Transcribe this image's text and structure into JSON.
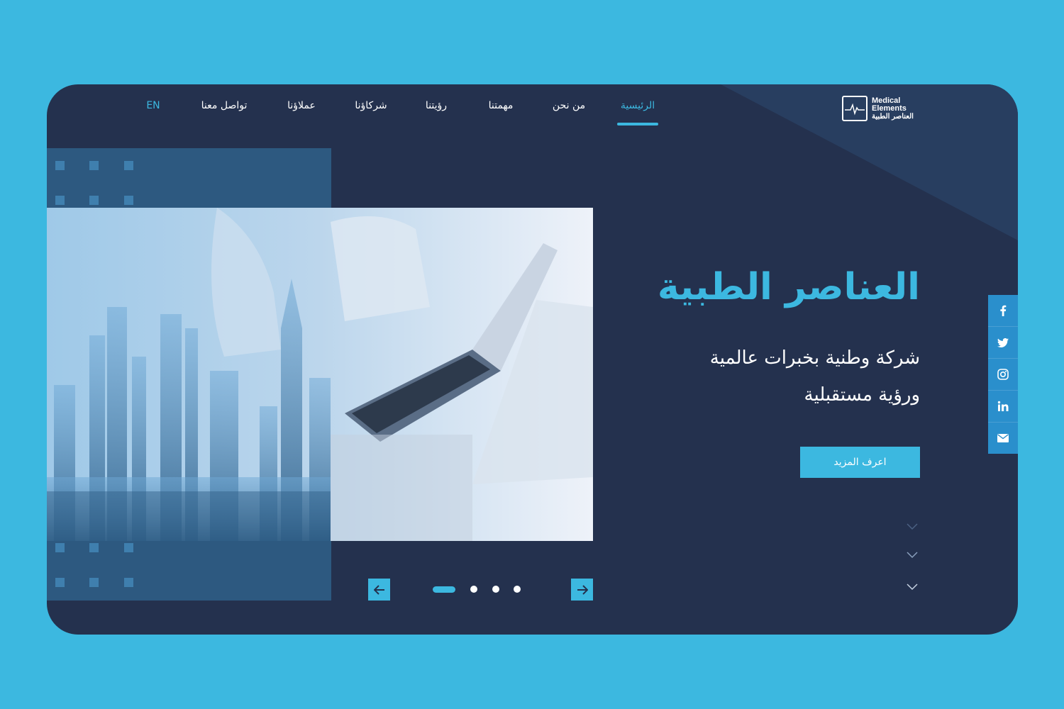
{
  "brand": {
    "name_en_line1": "Medical",
    "name_en_line2": "Elements",
    "name_ar": "العناصر الطبية"
  },
  "nav": {
    "items": [
      {
        "label": "الرئيسية",
        "active": true
      },
      {
        "label": "من نحن",
        "active": false
      },
      {
        "label": "مهمتنا",
        "active": false
      },
      {
        "label": "رؤيتنا",
        "active": false
      },
      {
        "label": "شركاؤنا",
        "active": false
      },
      {
        "label": "عملاؤنا",
        "active": false
      },
      {
        "label": "تواصل معنا",
        "active": false
      }
    ],
    "language": "EN"
  },
  "hero": {
    "title": "العناصر الطبية",
    "subtitle_line1": "شركة وطنية بخبرات عالمية",
    "subtitle_line2": "ورؤية مستقبلية",
    "cta_label": "اعرف المزيد"
  },
  "slider": {
    "total_slides": 4,
    "active_slide": 1
  },
  "social": [
    "facebook-icon",
    "twitter-icon",
    "instagram-icon",
    "linkedin-icon",
    "mail-icon"
  ],
  "colors": {
    "background": "#3cb8e0",
    "card": "#24314e",
    "accent": "#3cb8e0",
    "social_bar": "#2a8fcc"
  }
}
